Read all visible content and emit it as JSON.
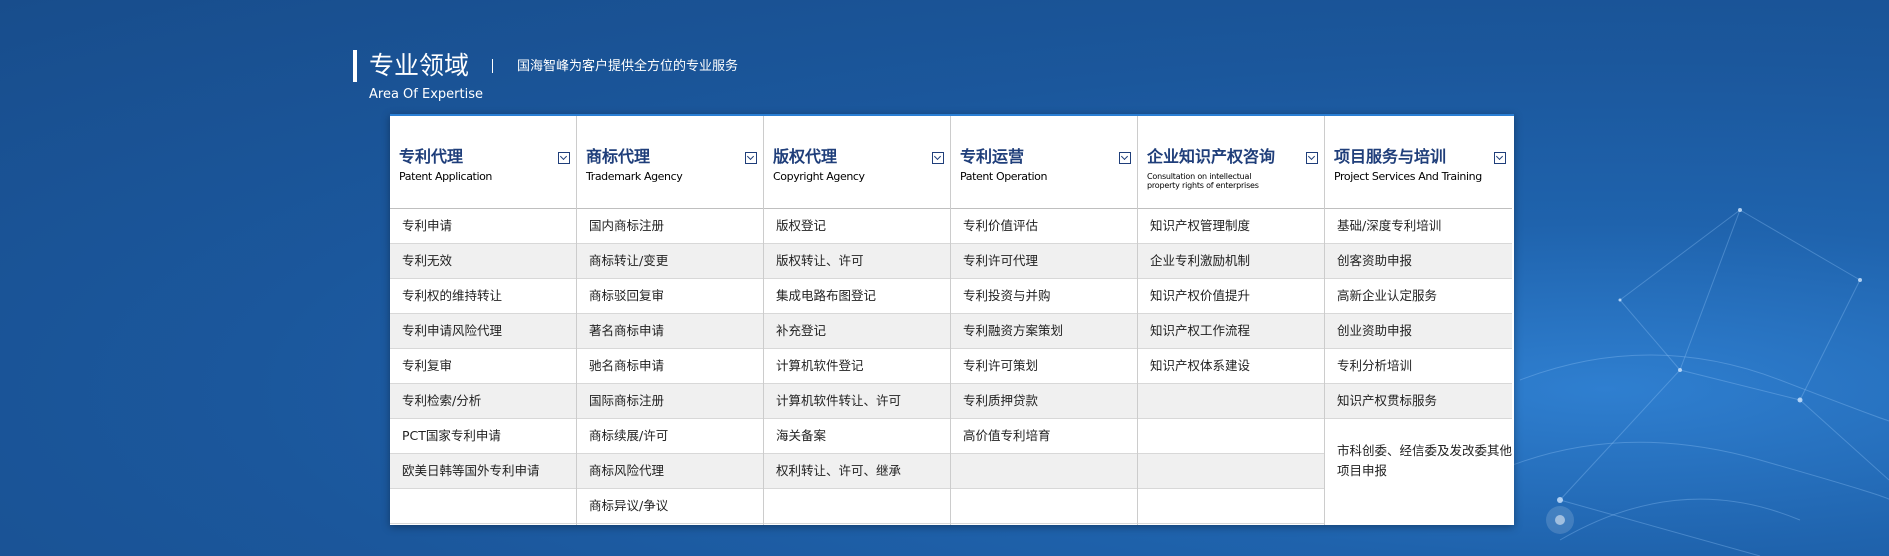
{
  "header": {
    "title": "专业领域",
    "subtitle": "国海智峰为客户提供全方位的专业服务",
    "title_en": "Area Of Expertise"
  },
  "colors": {
    "background": "#1b579c",
    "heading": "#1f3e7a",
    "panel_top_border": "#2b7fd4",
    "row_alt": "#f0f0f0"
  },
  "columns": [
    {
      "title": "专利代理",
      "subtitle": "Patent Application",
      "icon": "chevron-down-icon",
      "items": [
        "专利申请",
        "专利无效",
        "专利权的维持转让",
        "专利申请风险代理",
        "专利复审",
        "专利检索/分析",
        "PCT国家专利申请",
        "欧美日韩等国外专利申请",
        ""
      ]
    },
    {
      "title": "商标代理",
      "subtitle": "Trademark Agency",
      "icon": "chevron-down-icon",
      "items": [
        "国内商标注册",
        "商标转让/变更",
        "商标驳回复审",
        "著名商标申请",
        "驰名商标申请",
        "国际商标注册",
        "商标续展/许可",
        "商标风险代理",
        "商标异议/争议"
      ]
    },
    {
      "title": "版权代理",
      "subtitle": "Copyright Agency",
      "icon": "chevron-down-icon",
      "items": [
        "版权登记",
        "版权转让、许可",
        "集成电路布图登记",
        "补充登记",
        "计算机软件登记",
        "计算机软件转让、许可",
        "海关备案",
        "权利转让、许可、继承",
        ""
      ]
    },
    {
      "title": "专利运营",
      "subtitle": "Patent Operation",
      "icon": "chevron-down-icon",
      "items": [
        "专利价值评估",
        "专利许可代理",
        "专利投资与并购",
        "专利融资方案策划",
        "专利许可策划",
        "专利质押贷款",
        "高价值专利培育",
        "",
        ""
      ]
    },
    {
      "title": "企业知识产权咨询",
      "subtitle": "Consultation on intellectual property rights of enterprises",
      "icon": "chevron-down-icon",
      "items": [
        "知识产权管理制度",
        "企业专利激励机制",
        "知识产权价值提升",
        "知识产权工作流程",
        "知识产权体系建设",
        "",
        "",
        "",
        ""
      ]
    },
    {
      "title": "项目服务与培训",
      "subtitle": "Project Services And Training",
      "icon": "chevron-down-icon",
      "items": [
        "基础/深度专利培训",
        "创客资助申报",
        "高新企业认定服务",
        "创业资助申报",
        "专利分析培训",
        "知识产权贯标服务"
      ],
      "last_item": "市科创委、经信委及发改委其他项目申报"
    }
  ]
}
